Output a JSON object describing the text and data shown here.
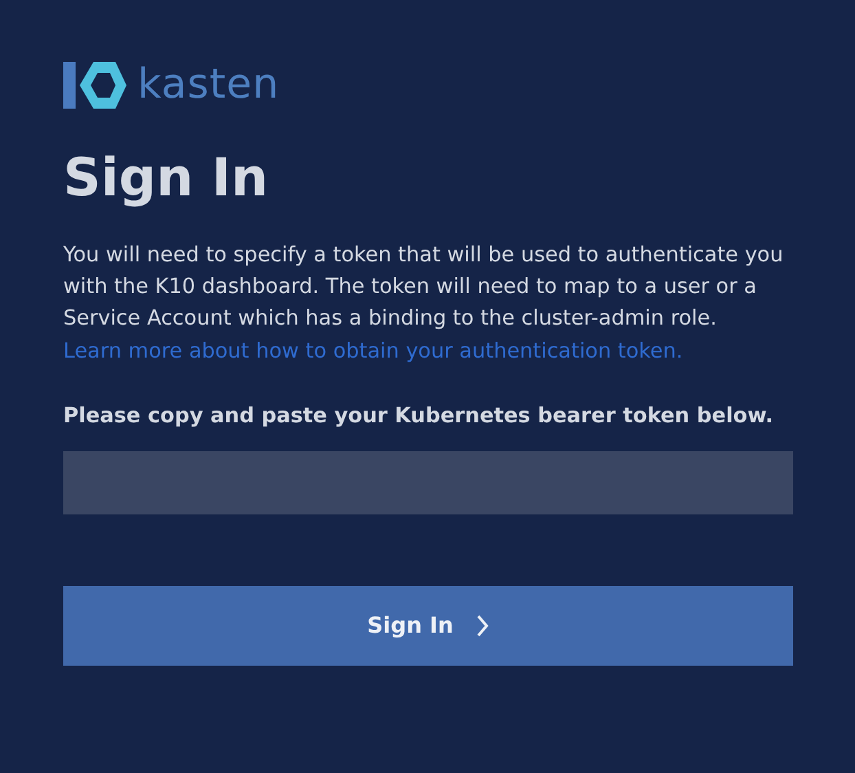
{
  "logo": {
    "text": "kasten"
  },
  "title": "Sign In",
  "description": "You will need to specify a token that will be used to authenticate you with the K10 dashboard. The token will need to map to a user or a Service Account which has a binding to the cluster-admin role.",
  "help_link": "Learn more about how to obtain your authentication token.",
  "token_label": "Please copy and paste your Kubernetes bearer token below.",
  "sign_in_button": {
    "label": "Sign In"
  }
}
